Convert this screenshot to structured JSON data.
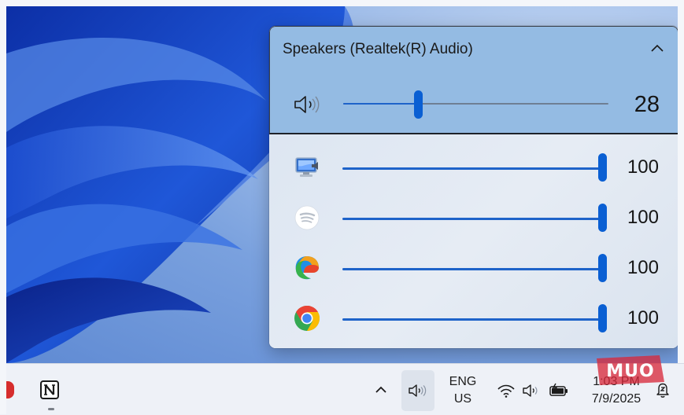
{
  "flyout": {
    "device_name": "Speakers (Realtek(R) Audio)",
    "master_volume": "28",
    "master_level_percent": 28,
    "icons": {
      "expand": "chevron-up-icon",
      "speaker": "speaker-icon"
    }
  },
  "apps": [
    {
      "name": "system-sounds",
      "icon": "system-sounds-icon",
      "volume": "100"
    },
    {
      "name": "spotify",
      "icon": "spotify-icon",
      "volume": "100"
    },
    {
      "name": "edge",
      "icon": "edge-icon",
      "volume": "100"
    },
    {
      "name": "chrome",
      "icon": "chrome-icon",
      "volume": "100"
    }
  ],
  "taskbar": {
    "language_line1": "ENG",
    "language_line2": "US",
    "time": "1:03 PM",
    "date": "7/9/2025",
    "icons": [
      "notion-icon",
      "show-hidden-icons-chevron",
      "volume-icon",
      "wifi-icon",
      "speaker-icon",
      "battery-icon",
      "notification-icon"
    ]
  },
  "watermark": {
    "text": "MUO"
  },
  "colors": {
    "accent": "#0a5fd3",
    "device_panel": "#94bbe3",
    "flyout_bg": "#e4ebf5",
    "taskbar_bg": "#eef1f7"
  }
}
